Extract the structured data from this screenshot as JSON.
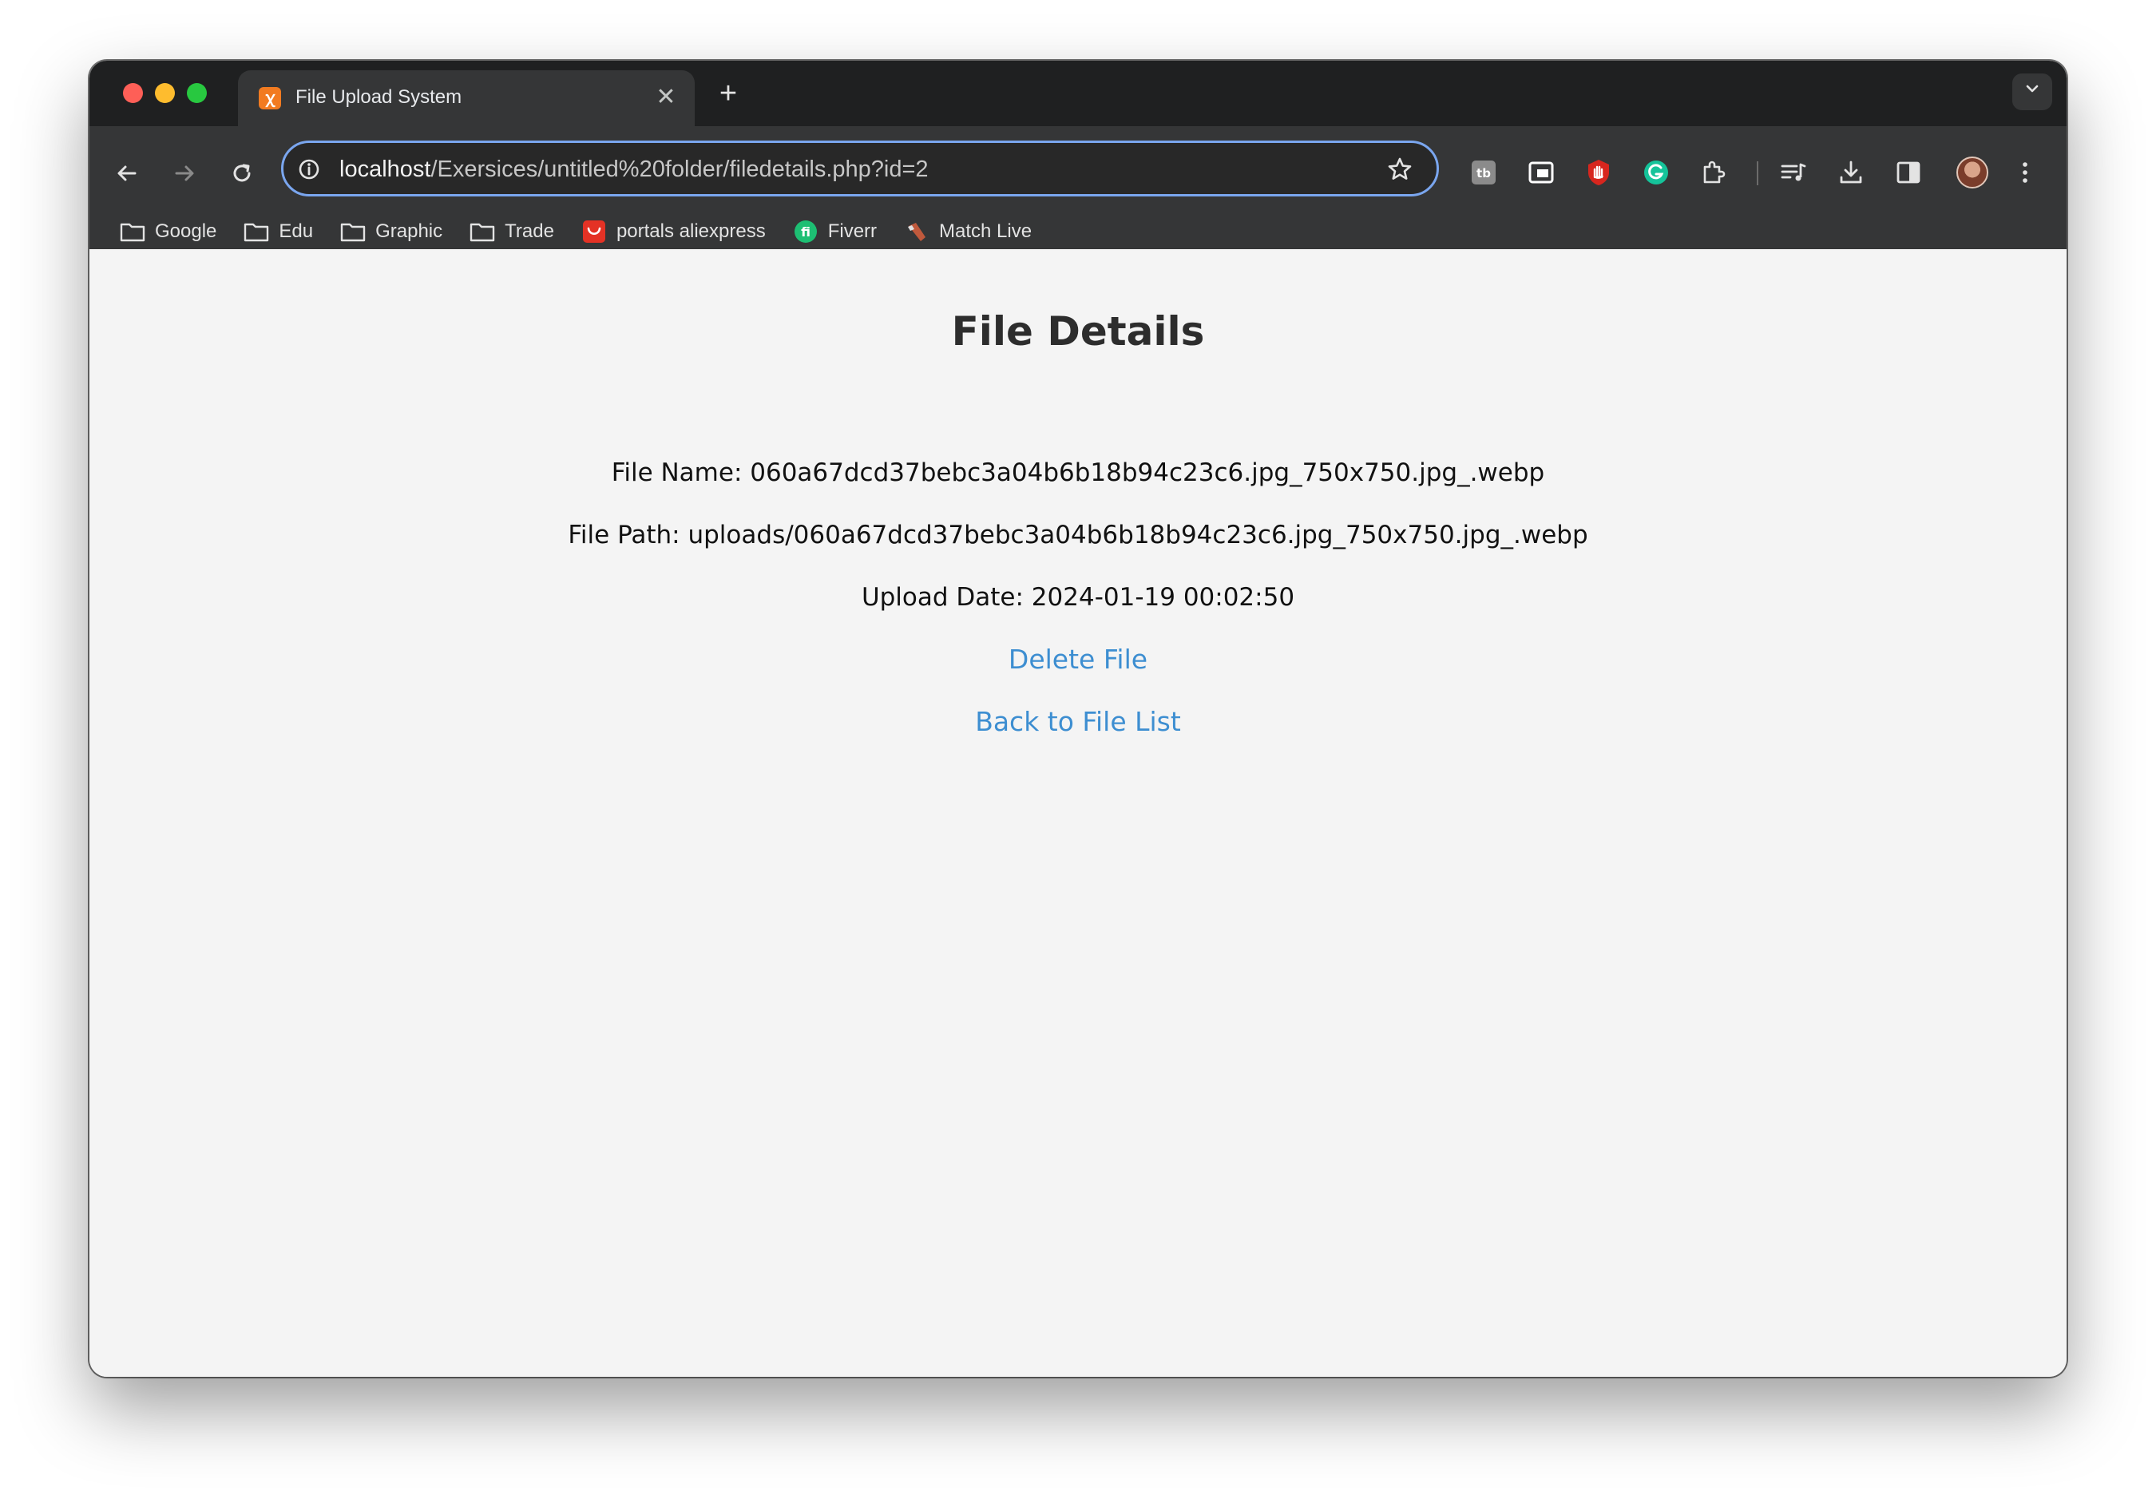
{
  "browser": {
    "tab": {
      "title": "File Upload System",
      "close_glyph": "✕"
    },
    "new_tab_glyph": "+",
    "tab_menu_glyph": "⌄",
    "address_bar": {
      "host": "localhost",
      "path": "/Exersices/untitled%20folder/filedetails.php?id=2"
    },
    "bookmarks": [
      {
        "label": "Google",
        "icon": "folder-icon"
      },
      {
        "label": "Edu",
        "icon": "folder-icon"
      },
      {
        "label": "Graphic",
        "icon": "folder-icon"
      },
      {
        "label": "Trade",
        "icon": "folder-icon"
      },
      {
        "label": "portals aliexpress",
        "icon": "aliexpress-icon"
      },
      {
        "label": "Fiverr",
        "icon": "fiverr-icon"
      },
      {
        "label": "Match Live",
        "icon": "match-live-icon"
      }
    ],
    "colors": {
      "tab_strip": "#1f2021",
      "toolbar": "#353637",
      "omnibox_focus": "#7aa6ef"
    }
  },
  "page": {
    "title": "File Details",
    "file_name_line": "File Name: 060a67dcd37bebc3a04b6b18b94c23c6.jpg_750x750.jpg_.webp",
    "file_path_line": "File Path: uploads/060a67dcd37bebc3a04b6b18b94c23c6.jpg_750x750.jpg_.webp",
    "upload_date_line": "Upload Date: 2024-01-19 00:02:50",
    "delete_link": "Delete File",
    "back_link": "Back to File List",
    "colors": {
      "background": "#f4f4f4",
      "heading": "#2d2d2d",
      "link": "#3d8ed1"
    }
  }
}
